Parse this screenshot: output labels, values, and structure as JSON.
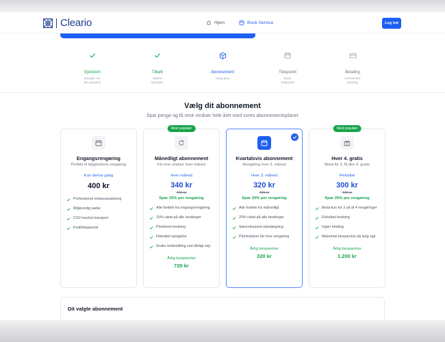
{
  "header": {
    "brand": "Cleario",
    "nav": {
      "home": "Hjem",
      "book": "Book Service"
    },
    "login": "Log ind"
  },
  "steps": [
    {
      "label": "Ejendom",
      "desc1": "Detaljer om",
      "desc2": "din ejendom",
      "state": "done"
    },
    {
      "label": "Tilkøb",
      "desc1": "Ekstra",
      "desc2": "tjenester",
      "state": "done"
    },
    {
      "label": "Abonnement",
      "desc1": "Vælg plan",
      "desc2": "",
      "state": "active"
    },
    {
      "label": "Tidspunkt",
      "desc1": "Book",
      "desc2": "tidspunkt",
      "state": "pending"
    },
    {
      "label": "Betaling",
      "desc1": "Gennemfør",
      "desc2": "betaling",
      "state": "pending"
    }
  ],
  "main": {
    "title": "Vælg dit abonnement",
    "subtitle": "Spar penge og få rene vinduer hele året med vores abonnementsplaner"
  },
  "plans": [
    {
      "name": "Engangsrengøring",
      "tagline": "Perfekt til lejlighedsvis rengøring",
      "freq": "Kun denne gang",
      "price": "400 kr",
      "features": [
        "Professionel vinduespudsning",
        "Miljøvenlig sæbe",
        "CO2-neutral transport",
        "Kvalitetsgaranti"
      ]
    },
    {
      "badge": "Mest populær",
      "name": "Månedligt abonnement",
      "tagline": "Få rene vinduer hver måned",
      "freq": "Hver måned",
      "price": "340 kr",
      "old_price": "400 kr",
      "savings": "Spar 15% per rengøring",
      "features": [
        "Alle fordele fra engangsrengøring",
        "15% rabat på alle bookinger",
        "Prioriteret booking",
        "Fleksibel opsigelse",
        "Gratis ombestilling ved dårligt vejr"
      ],
      "annual_label": "Årlig besparelse",
      "annual_value": "720 kr"
    },
    {
      "name": "Kvartalsvis abonnement",
      "tagline": "Rengøring hver 3. måned",
      "freq": "Hver 3. måned",
      "price": "320 kr",
      "old_price": "400 kr",
      "savings": "Spar 20% per rengøring",
      "features": [
        "Alle fordele fra månedligt",
        "20% rabat på alle bookinger",
        "Sæsonbaseret planlægning",
        "Påmindelser før hver rengøring"
      ],
      "annual_label": "Årlig besparelse",
      "annual_value": "320 kr",
      "selected": true
    },
    {
      "badge": "Mest populær",
      "name": "Hver 4. gratis",
      "tagline": "Betal for 3, få den 4. gratis",
      "freq": "Fleksibel",
      "price": "300 kr",
      "old_price": "400 kr",
      "savings": "Spar 25% per rengøring",
      "features": [
        "Betal kun for 3 ud af 4 rengøringer",
        "Fleksibel booking",
        "Ingen binding",
        "Maksimal besparelse på lang sigt"
      ],
      "annual_label": "Årlig besparelse",
      "annual_value": "1.200 kr"
    }
  ],
  "summary": {
    "title": "Dit valgte abonnement"
  },
  "colors": {
    "primary": "#1d5ff0",
    "success": "#16a34a",
    "brand": "#1d3d8f"
  },
  "icons": {
    "home": "home-icon",
    "calendar": "calendar-icon",
    "box": "box-icon",
    "card": "credit-card-icon",
    "refresh": "refresh-icon",
    "gift": "gift-icon",
    "check": "check-icon"
  }
}
